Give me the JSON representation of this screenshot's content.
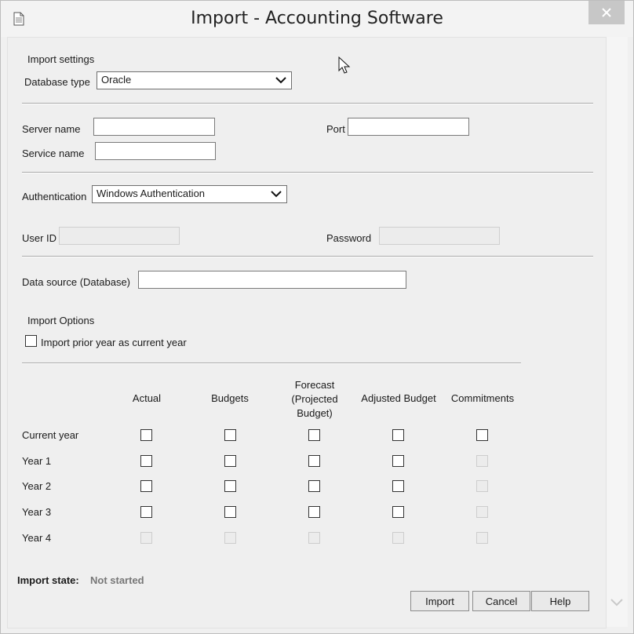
{
  "window": {
    "title": "Import - Accounting Software"
  },
  "import_settings": {
    "heading": "Import settings",
    "database_type_label": "Database type",
    "database_type_value": "Oracle"
  },
  "connection": {
    "server_name_label": "Server name",
    "server_name_value": "",
    "port_label": "Port",
    "port_value": "",
    "service_name_label": "Service name",
    "service_name_value": ""
  },
  "auth": {
    "authentication_label": "Authentication",
    "authentication_value": "Windows Authentication",
    "user_id_label": "User ID",
    "password_label": "Password"
  },
  "data_source": {
    "label": "Data source (Database)",
    "value": ""
  },
  "import_options": {
    "heading": "Import Options",
    "prior_year_label": "Import prior year as current year",
    "prior_year_checked": false
  },
  "grid": {
    "columns": [
      "Actual",
      "Budgets",
      "Forecast\n(Projected\nBudget)",
      "Adjusted Budget",
      "Commitments"
    ],
    "rows": [
      {
        "label": "Current year",
        "enabled": [
          true,
          true,
          true,
          true,
          true
        ]
      },
      {
        "label": "Year 1",
        "enabled": [
          true,
          true,
          true,
          true,
          false
        ]
      },
      {
        "label": "Year 2",
        "enabled": [
          true,
          true,
          true,
          true,
          false
        ]
      },
      {
        "label": "Year 3",
        "enabled": [
          true,
          true,
          true,
          true,
          false
        ]
      },
      {
        "label": "Year 4",
        "enabled": [
          false,
          false,
          false,
          false,
          false
        ]
      }
    ]
  },
  "status": {
    "label": "Import state:",
    "value": "Not started"
  },
  "buttons": {
    "import": "Import",
    "cancel": "Cancel",
    "help": "Help"
  },
  "icons": {
    "window_icon": "document-icon",
    "close": "close-icon",
    "cursor": "mouse-pointer-icon"
  }
}
